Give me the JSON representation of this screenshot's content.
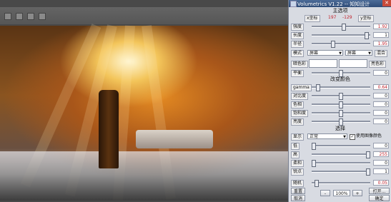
{
  "panel": {
    "title": "Volumetrics  V1.22 -- 知知设计",
    "close": "✕",
    "main_section": "主选项",
    "x_label": "x坐标",
    "x_value": "197",
    "y_value": "-129",
    "y_label": "y坐标",
    "sliders_main": [
      {
        "label": "强度",
        "value": "1.92",
        "fraction": 0.55
      },
      {
        "label": "长度",
        "value": "1",
        "fraction": 0.97
      },
      {
        "label": "半径",
        "value": "1.95",
        "fraction": 0.36
      }
    ],
    "mode_label": "模式",
    "mode_value": "屏幕",
    "blend_value": "屏幕",
    "blend_label": "混合",
    "dark_color_label": "暗色彩",
    "bright_color_label": "亮色彩",
    "balance_label": "平衡",
    "balance_value": "0",
    "balance_fraction": 0.5,
    "color_section": "改变颜色",
    "color_sliders": [
      {
        "label": "gamma",
        "value": "0.64",
        "fraction": 0.08
      },
      {
        "label": "对比度",
        "value": "0",
        "fraction": 0.5
      },
      {
        "label": "色相",
        "value": "0",
        "fraction": 0.5
      },
      {
        "label": "饱和度",
        "value": "0",
        "fraction": 0.5
      },
      {
        "label": "亮度",
        "value": "0",
        "fraction": 0.5
      }
    ],
    "select_section": "选择",
    "display_label": "显示",
    "display_value": "正常",
    "use_image_label": "使用图像颜色",
    "use_image_checked": true,
    "select_sliders": [
      {
        "label": "低",
        "value": "0",
        "fraction": 0.0
      },
      {
        "label": "高",
        "value": "255",
        "fraction": 1.0
      },
      {
        "label": "柔和",
        "value": "0",
        "fraction": 0.0
      },
      {
        "label": "锐点",
        "value": "1",
        "fraction": 1.0
      }
    ],
    "random_label": "随机",
    "random_value": "0.05",
    "random_fraction": 0.05,
    "reset_label": "重置",
    "minus_label": "-",
    "zoom_value": "100%",
    "plus_label": "+",
    "open_label": "打开...",
    "cancel_label": "取消",
    "ok_label": "确定"
  }
}
